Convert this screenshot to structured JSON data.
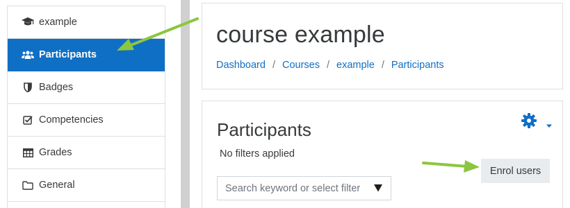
{
  "sidebar": {
    "items": [
      {
        "label": "example",
        "icon": "graduation-cap-icon",
        "active": false
      },
      {
        "label": "Participants",
        "icon": "users-icon",
        "active": true
      },
      {
        "label": "Badges",
        "icon": "shield-icon",
        "active": false
      },
      {
        "label": "Competencies",
        "icon": "checkbox-icon",
        "active": false
      },
      {
        "label": "Grades",
        "icon": "table-icon",
        "active": false
      },
      {
        "label": "General",
        "icon": "folder-icon",
        "active": false
      }
    ]
  },
  "header": {
    "title": "course example",
    "breadcrumb": [
      "Dashboard",
      "Courses",
      "example",
      "Participants"
    ],
    "separator": "/"
  },
  "participants": {
    "title": "Participants",
    "filter_status": "No filters applied",
    "enrol_button": "Enrol users",
    "search_placeholder": "Search keyword or select filter",
    "settings_icon": "gear-icon"
  },
  "colors": {
    "accent": "#0f6fc5",
    "annotation_arrow": "#8cc63f",
    "button_bg": "#e9ecef"
  }
}
